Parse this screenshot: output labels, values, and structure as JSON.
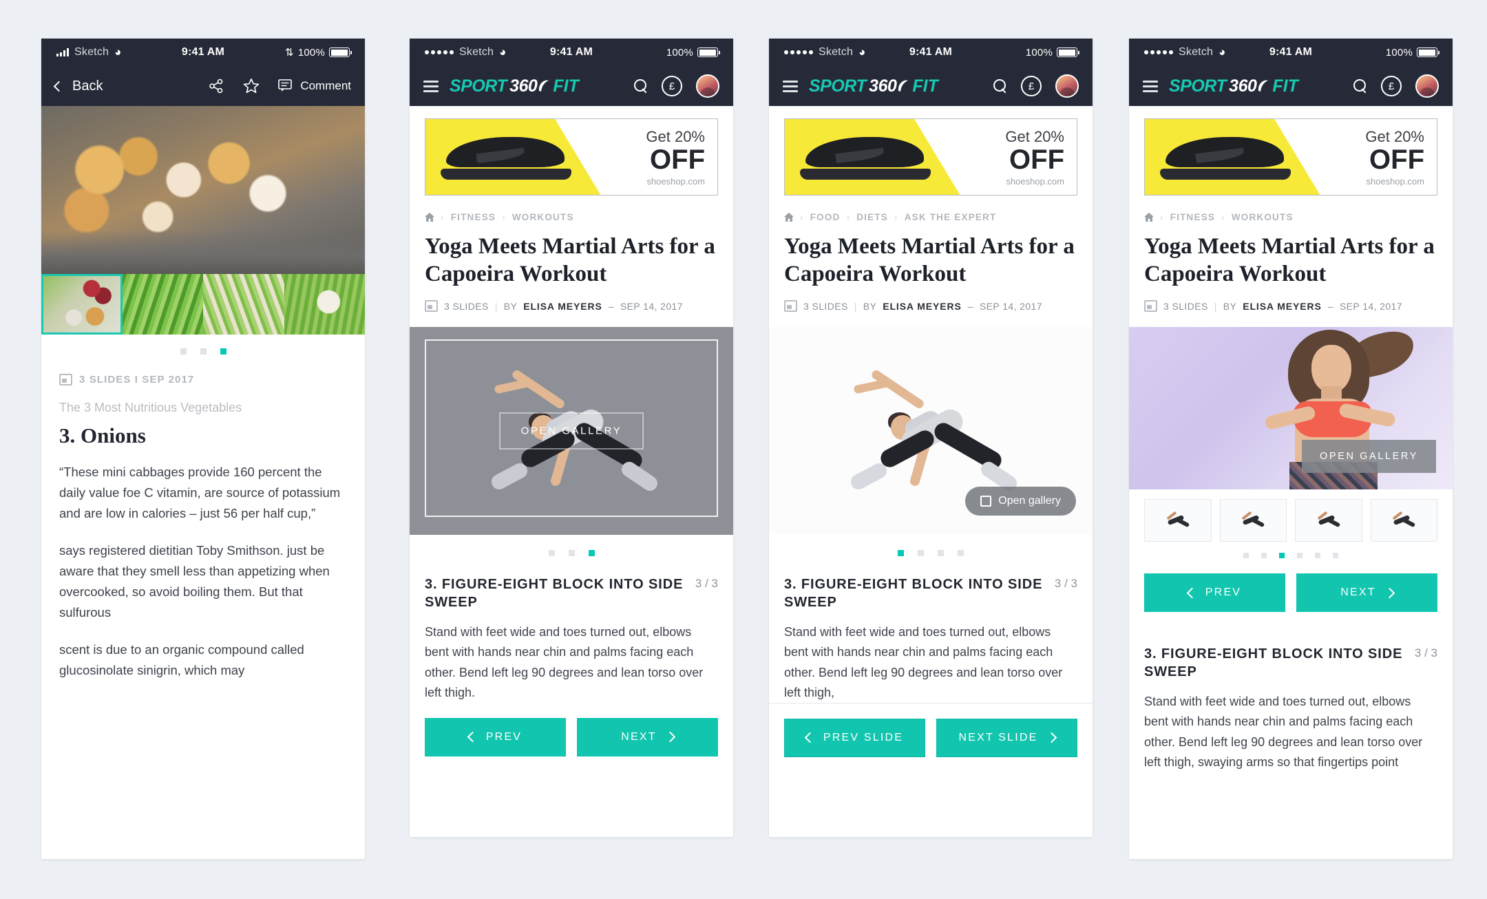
{
  "meta": {
    "accent": "#12c5ae",
    "dark_nav": "#262a38",
    "page_bg": "#eceff3"
  },
  "status_bar": {
    "carrier": "Sketch",
    "time": "9:41 AM",
    "battery": "100%"
  },
  "panel1": {
    "nav": {
      "back": "Back",
      "comment": "Comment"
    },
    "meta": "3 SLIDES I SEP 2017",
    "kicker": "The 3 Most Nutritious Vegetables",
    "headline": "3. Onions",
    "paragraphs": [
      "“These mini cabbages provide 160 percent the daily value foe C vitamin, are source of potassium and are low in calories – just 56 per half cup,”",
      "says registered dietitian Toby Smithson. just be aware that they smell less than appetizing when overcooked, so avoid boiling them. But that sulfurous",
      "scent is due to an organic compound called glucosinolate sinigrin, which may"
    ],
    "pager": {
      "count": 3,
      "active": 3
    },
    "thumbs": [
      "mixed-vegetables",
      "scallions",
      "leeks",
      "garlic"
    ]
  },
  "brand": {
    "sport": "SPORT",
    "number": "360",
    "fit": "FIT",
    "currency": "£"
  },
  "ad": {
    "get": "Get 20%",
    "off": "OFF",
    "url": "shoeshop.com"
  },
  "article": {
    "title": "Yoga Meets Martial Arts for a Capoeira Workout",
    "slides_label": "3 SLIDES",
    "by_label": "BY",
    "author": "ELISA MEYERS",
    "date": "SEP 14, 2017",
    "sep": "|",
    "dash": "–"
  },
  "breadcrumbs": {
    "fitness": [
      "FITNESS",
      "WORKOUTS"
    ],
    "food": [
      "FOOD",
      "DIETS",
      "ASK THE EXPERT"
    ],
    "sep": "›"
  },
  "gallery": {
    "open_caps": "OPEN GALLERY",
    "open_pill": "Open gallery"
  },
  "slide": {
    "title": "3. FIGURE-EIGHT BLOCK INTO SIDE SWEEP",
    "count": "3 / 3",
    "body_short": "Stand with feet wide and toes turned out, elbows bent with hands near chin and palms facing each other. Bend left leg 90 degrees and lean torso over left thigh.",
    "body_mid": "Stand with feet wide and toes turned out, elbows bent with hands near chin and palms facing each other. Bend left leg 90 degrees and lean torso over left thigh,",
    "body_long": "Stand with feet wide and toes turned out, elbows bent with hands near chin and palms facing each other. Bend left leg 90 degrees and lean torso over left thigh, swaying arms so that fingertips point"
  },
  "buttons": {
    "prev": "PREV",
    "next": "NEXT",
    "prev_slide": "PREV SLIDE",
    "next_slide": "NEXT SLIDE"
  },
  "pagers": {
    "panel2": {
      "count": 3,
      "active": 3
    },
    "panel3": {
      "count": 4,
      "active": 1
    },
    "panel4": {
      "count": 6,
      "active": 3
    }
  }
}
